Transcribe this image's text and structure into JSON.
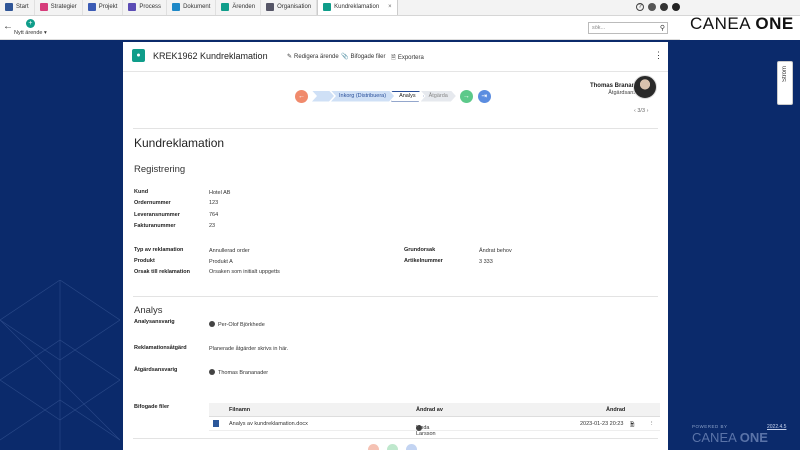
{
  "tabs": [
    {
      "label": "Start",
      "icon": "home-icon",
      "color": "#2f5597"
    },
    {
      "label": "Strategier",
      "icon": "strategies-icon",
      "color": "#d63b7a"
    },
    {
      "label": "Projekt",
      "icon": "project-icon",
      "color": "#3b5bb5"
    },
    {
      "label": "Process",
      "icon": "process-icon",
      "color": "#5b4cb5"
    },
    {
      "label": "Dokument",
      "icon": "document-icon",
      "color": "#1e88c7"
    },
    {
      "label": "Ärenden",
      "icon": "cases-icon",
      "color": "#0f9d8a"
    },
    {
      "label": "Organisation",
      "icon": "organisation-icon",
      "color": "#556"
    },
    {
      "label": "Kundreklamation",
      "icon": "case-tab-icon",
      "color": "#0f9d8a",
      "active": true
    }
  ],
  "toolbar": {
    "new_case_label": "Nytt ärende",
    "search_placeholder": "sök..."
  },
  "brand": {
    "part1": "CANEA",
    "part2": "ONE"
  },
  "case": {
    "title": "KREK1962 Kundreklamation",
    "actions": {
      "edit": "Redigera ärende",
      "attach": "Bifogade filer",
      "export": "Exportera"
    }
  },
  "workflow": {
    "steps": [
      "Inkorg (Distribuera)",
      "Analys",
      "Åtgärda"
    ],
    "current": "Analys"
  },
  "responsible": {
    "name": "Thomas Brananader",
    "role": "Åtgärdsansvarig",
    "pager": "3/3"
  },
  "form": {
    "heading": "Kundreklamation",
    "registration": {
      "heading": "Registrering",
      "kund_label": "Kund",
      "kund_value": "Hotel AB",
      "order_label": "Ordernummer",
      "order_value": "123",
      "lev_label": "Leveransnummer",
      "lev_value": "764",
      "faktura_label": "Fakturanummer",
      "faktura_value": "23",
      "typ_label": "Typ av reklamation",
      "typ_value": "Annullerad order",
      "produkt_label": "Produkt",
      "produkt_value": "Produkt A",
      "orsak_label": "Orsak till reklamation",
      "orsak_value": "Orsaken som initialt uppgetts",
      "grund_label": "Grundorsak",
      "grund_value": "Ändrat behov",
      "artikel_label": "Artikelnummer",
      "artikel_value": "3 333"
    },
    "analysis": {
      "heading": "Analys",
      "ansvarig_label": "Analysansvarig",
      "ansvarig_value": "Per-Olof Björkhede",
      "atgard_label": "Reklamationsåtgärd",
      "atgard_value": "Planerade åtgärder skrivs in här.",
      "atgardsansv_label": "Åtgärdsansvarig",
      "atgardsansv_value": "Thomas Brananader"
    },
    "files": {
      "label": "Bifogade filer",
      "columns": [
        "Filnamn",
        "Ändrad av",
        "Ändrad"
      ],
      "rows": [
        {
          "name": "Analys av kundreklamation.docx",
          "by": "Linda Larsson",
          "date": "2023-01-23 20:23"
        }
      ]
    }
  },
  "side": {
    "stream": "Ström"
  },
  "footer": {
    "powered": "POWERED BY",
    "version": "2022.4.5",
    "brand1": "CANEA",
    "brand2": "ONE"
  }
}
